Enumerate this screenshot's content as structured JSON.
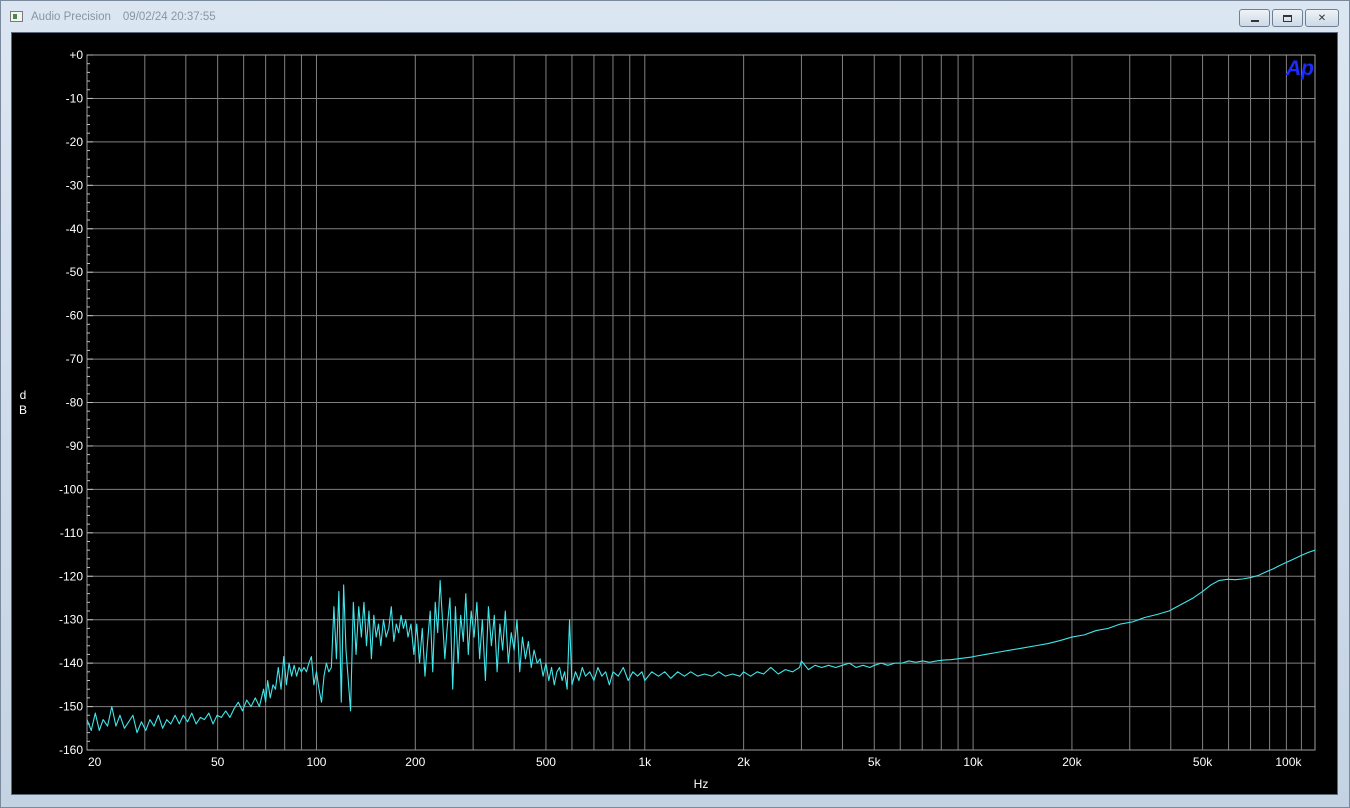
{
  "window": {
    "app_title": "Audio Precision",
    "timestamp": "09/02/24 20:37:55",
    "min_glyph": "minimize-icon",
    "max_glyph": "maximize-icon",
    "close_glyph": "✕"
  },
  "logo": {
    "text": "Ap"
  },
  "colors": {
    "background": "#000000",
    "grid": "#808080",
    "trace": "#3fe6ea",
    "logo": "#1a2cff"
  },
  "chart_data": {
    "type": "line",
    "title": "",
    "xlabel": "Hz",
    "ylabel": "dB",
    "xscale": "log",
    "xlim": [
      20,
      110000
    ],
    "ylim": [
      -160,
      0
    ],
    "grid": true,
    "x_ticks": [
      {
        "v": 20,
        "label": "20"
      },
      {
        "v": 50,
        "label": "50"
      },
      {
        "v": 100,
        "label": "100"
      },
      {
        "v": 200,
        "label": "200"
      },
      {
        "v": 500,
        "label": "500"
      },
      {
        "v": 1000,
        "label": "1k"
      },
      {
        "v": 2000,
        "label": "2k"
      },
      {
        "v": 5000,
        "label": "5k"
      },
      {
        "v": 10000,
        "label": "10k"
      },
      {
        "v": 20000,
        "label": "20k"
      },
      {
        "v": 50000,
        "label": "50k"
      },
      {
        "v": 100000,
        "label": "100k"
      }
    ],
    "y_ticks": [
      {
        "v": 0,
        "label": "+0"
      },
      {
        "v": -10,
        "label": "-10"
      },
      {
        "v": -20,
        "label": "-20"
      },
      {
        "v": -30,
        "label": "-30"
      },
      {
        "v": -40,
        "label": "-40"
      },
      {
        "v": -50,
        "label": "-50"
      },
      {
        "v": -60,
        "label": "-60"
      },
      {
        "v": -70,
        "label": "-70"
      },
      {
        "v": -80,
        "label": "-80"
      },
      {
        "v": -90,
        "label": "-90"
      },
      {
        "v": -100,
        "label": "-100"
      },
      {
        "v": -110,
        "label": "-110"
      },
      {
        "v": -120,
        "label": "-120"
      },
      {
        "v": -130,
        "label": "-130"
      },
      {
        "v": -140,
        "label": "-140"
      },
      {
        "v": -150,
        "label": "-150"
      },
      {
        "v": -160,
        "label": "-160"
      }
    ],
    "series": [
      {
        "color": "#3fe6ea",
        "points": [
          [
            20,
            -153
          ],
          [
            20.6,
            -155.5
          ],
          [
            21.2,
            -151.5
          ],
          [
            21.8,
            -155.5
          ],
          [
            22.4,
            -153
          ],
          [
            23.1,
            -154.5
          ],
          [
            23.8,
            -150
          ],
          [
            24.5,
            -154.5
          ],
          [
            25.2,
            -152
          ],
          [
            26,
            -155
          ],
          [
            26.8,
            -153.5
          ],
          [
            27.6,
            -152
          ],
          [
            28.4,
            -156
          ],
          [
            29.3,
            -153.5
          ],
          [
            30.2,
            -155.5
          ],
          [
            31.1,
            -153
          ],
          [
            32,
            -154.5
          ],
          [
            33,
            -152
          ],
          [
            34,
            -155
          ],
          [
            35,
            -153
          ],
          [
            36,
            -154
          ],
          [
            37.1,
            -152
          ],
          [
            38.2,
            -154
          ],
          [
            39.3,
            -152
          ],
          [
            40.5,
            -153.5
          ],
          [
            41.7,
            -151.5
          ],
          [
            43,
            -154
          ],
          [
            44.3,
            -152.5
          ],
          [
            45.6,
            -153
          ],
          [
            47,
            -151.5
          ],
          [
            48.4,
            -154
          ],
          [
            49.8,
            -152
          ],
          [
            51.3,
            -152.5
          ],
          [
            52.9,
            -151
          ],
          [
            54.5,
            -152.5
          ],
          [
            56.1,
            -150.5
          ],
          [
            57.8,
            -149
          ],
          [
            59.5,
            -151
          ],
          [
            61.3,
            -148.5
          ],
          [
            63.2,
            -150
          ],
          [
            65.1,
            -148
          ],
          [
            67,
            -150
          ],
          [
            69,
            -146
          ],
          [
            70,
            -149
          ],
          [
            71,
            -144
          ],
          [
            72.3,
            -148
          ],
          [
            73.7,
            -145
          ],
          [
            75,
            -146
          ],
          [
            76.5,
            -141
          ],
          [
            78,
            -146
          ],
          [
            79.5,
            -138.5
          ],
          [
            81,
            -145
          ],
          [
            82.5,
            -140
          ],
          [
            84,
            -143
          ],
          [
            85.5,
            -140.5
          ],
          [
            87,
            -143
          ],
          [
            88.5,
            -141
          ],
          [
            90,
            -142
          ],
          [
            91.6,
            -141
          ],
          [
            93.2,
            -142
          ],
          [
            94.8,
            -140
          ],
          [
            96.5,
            -138.5
          ],
          [
            98.2,
            -145
          ],
          [
            100,
            -142
          ],
          [
            101.8,
            -146
          ],
          [
            103.6,
            -149
          ],
          [
            105.4,
            -143
          ],
          [
            107.2,
            -140
          ],
          [
            109,
            -142
          ],
          [
            111,
            -141
          ],
          [
            113,
            -127
          ],
          [
            115,
            -139
          ],
          [
            117,
            -123.5
          ],
          [
            119,
            -149
          ],
          [
            121,
            -122
          ],
          [
            123,
            -137
          ],
          [
            125,
            -144
          ],
          [
            127,
            -151
          ],
          [
            129.5,
            -126
          ],
          [
            132,
            -138
          ],
          [
            134.5,
            -127
          ],
          [
            137,
            -134
          ],
          [
            139.5,
            -126
          ],
          [
            142,
            -136
          ],
          [
            144.5,
            -128
          ],
          [
            147,
            -139
          ],
          [
            149.5,
            -129
          ],
          [
            152,
            -134
          ],
          [
            154.5,
            -131
          ],
          [
            157,
            -136
          ],
          [
            160,
            -130
          ],
          [
            163,
            -134
          ],
          [
            166,
            -132
          ],
          [
            169,
            -127
          ],
          [
            172,
            -135
          ],
          [
            175,
            -131
          ],
          [
            178,
            -133
          ],
          [
            181,
            -129
          ],
          [
            184,
            -132
          ],
          [
            187,
            -130
          ],
          [
            190,
            -134
          ],
          [
            194,
            -131
          ],
          [
            198,
            -138
          ],
          [
            202,
            -131
          ],
          [
            206,
            -140
          ],
          [
            210,
            -132
          ],
          [
            214,
            -143
          ],
          [
            218,
            -135
          ],
          [
            222,
            -128
          ],
          [
            226,
            -142
          ],
          [
            230,
            -126
          ],
          [
            234,
            -133
          ],
          [
            238,
            -121
          ],
          [
            242,
            -130
          ],
          [
            246,
            -139
          ],
          [
            250,
            -132
          ],
          [
            255,
            -125
          ],
          [
            260,
            -146
          ],
          [
            265,
            -127
          ],
          [
            270,
            -140
          ],
          [
            275,
            -129
          ],
          [
            280,
            -135
          ],
          [
            285,
            -124
          ],
          [
            290,
            -138
          ],
          [
            296,
            -128
          ],
          [
            302,
            -134
          ],
          [
            308,
            -126
          ],
          [
            314,
            -139
          ],
          [
            320,
            -130
          ],
          [
            327,
            -144
          ],
          [
            334,
            -127
          ],
          [
            341,
            -136
          ],
          [
            348,
            -129
          ],
          [
            355,
            -142
          ],
          [
            362,
            -131
          ],
          [
            369,
            -137
          ],
          [
            376,
            -128
          ],
          [
            384,
            -140
          ],
          [
            392,
            -133
          ],
          [
            400,
            -137
          ],
          [
            408,
            -130
          ],
          [
            416,
            -142
          ],
          [
            424,
            -134
          ],
          [
            433,
            -139
          ],
          [
            442,
            -135
          ],
          [
            451,
            -141
          ],
          [
            460,
            -137
          ],
          [
            470,
            -140
          ],
          [
            480,
            -139
          ],
          [
            490,
            -143
          ],
          [
            500,
            -140
          ],
          [
            510,
            -144
          ],
          [
            520,
            -141
          ],
          [
            530,
            -145
          ],
          [
            540,
            -142
          ],
          [
            550,
            -141
          ],
          [
            560,
            -144
          ],
          [
            570,
            -142
          ],
          [
            580,
            -146
          ],
          [
            590,
            -130
          ],
          [
            600,
            -145
          ],
          [
            615,
            -142
          ],
          [
            630,
            -144
          ],
          [
            645,
            -141
          ],
          [
            660,
            -143
          ],
          [
            680,
            -142
          ],
          [
            700,
            -144
          ],
          [
            720,
            -141
          ],
          [
            740,
            -143
          ],
          [
            760,
            -142
          ],
          [
            780,
            -145
          ],
          [
            800,
            -142
          ],
          [
            830,
            -143
          ],
          [
            860,
            -141
          ],
          [
            890,
            -144
          ],
          [
            920,
            -142
          ],
          [
            950,
            -143
          ],
          [
            980,
            -142
          ],
          [
            1000,
            -144
          ],
          [
            1050,
            -142
          ],
          [
            1100,
            -143
          ],
          [
            1150,
            -142
          ],
          [
            1200,
            -143.5
          ],
          [
            1260,
            -142
          ],
          [
            1320,
            -143
          ],
          [
            1380,
            -142
          ],
          [
            1450,
            -143
          ],
          [
            1520,
            -142.5
          ],
          [
            1600,
            -143
          ],
          [
            1680,
            -142
          ],
          [
            1760,
            -143
          ],
          [
            1850,
            -142.5
          ],
          [
            1950,
            -143
          ],
          [
            2000,
            -142
          ],
          [
            2100,
            -143
          ],
          [
            2200,
            -142
          ],
          [
            2300,
            -142.5
          ],
          [
            2420,
            -141
          ],
          [
            2550,
            -142.5
          ],
          [
            2680,
            -141.5
          ],
          [
            2820,
            -142
          ],
          [
            2960,
            -141
          ],
          [
            3000,
            -139.5
          ],
          [
            3150,
            -141.5
          ],
          [
            3300,
            -140.5
          ],
          [
            3460,
            -141
          ],
          [
            3630,
            -140.5
          ],
          [
            3810,
            -141
          ],
          [
            4000,
            -140.5
          ],
          [
            4200,
            -140
          ],
          [
            4400,
            -141
          ],
          [
            4620,
            -140.5
          ],
          [
            4850,
            -141
          ],
          [
            5000,
            -140.5
          ],
          [
            5250,
            -140
          ],
          [
            5500,
            -140.5
          ],
          [
            5780,
            -140
          ],
          [
            6070,
            -140
          ],
          [
            6370,
            -139.5
          ],
          [
            6690,
            -139.8
          ],
          [
            7020,
            -139.5
          ],
          [
            7370,
            -139.8
          ],
          [
            7740,
            -139.5
          ],
          [
            8130,
            -139.3
          ],
          [
            8540,
            -139.2
          ],
          [
            8970,
            -139
          ],
          [
            9420,
            -138.8
          ],
          [
            9890,
            -138.6
          ],
          [
            10000,
            -138.5
          ],
          [
            10900,
            -138
          ],
          [
            11900,
            -137.5
          ],
          [
            13000,
            -137
          ],
          [
            14200,
            -136.5
          ],
          [
            15500,
            -136
          ],
          [
            16900,
            -135.5
          ],
          [
            18400,
            -134.8
          ],
          [
            20000,
            -134
          ],
          [
            21800,
            -133.5
          ],
          [
            23700,
            -132.5
          ],
          [
            25800,
            -132
          ],
          [
            28100,
            -131
          ],
          [
            30600,
            -130.5
          ],
          [
            33300,
            -129.5
          ],
          [
            36300,
            -128.8
          ],
          [
            39500,
            -128
          ],
          [
            43000,
            -126.5
          ],
          [
            46800,
            -125
          ],
          [
            50000,
            -123.5
          ],
          [
            53000,
            -122
          ],
          [
            56000,
            -121
          ],
          [
            59500,
            -120.7
          ],
          [
            63000,
            -120.8
          ],
          [
            66500,
            -120.6
          ],
          [
            70000,
            -120.3
          ],
          [
            74000,
            -119.8
          ],
          [
            78000,
            -119
          ],
          [
            82000,
            -118.3
          ],
          [
            86000,
            -117.5
          ],
          [
            90000,
            -116.8
          ],
          [
            95000,
            -116
          ],
          [
            100000,
            -115.2
          ],
          [
            105000,
            -114.5
          ],
          [
            110000,
            -114
          ]
        ]
      }
    ]
  }
}
